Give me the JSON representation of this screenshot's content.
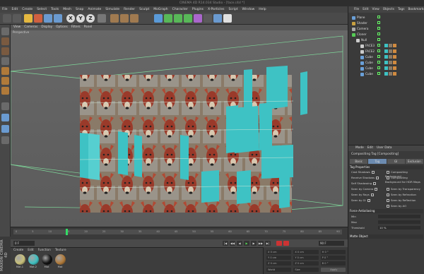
{
  "window": {
    "title": "CINEMA 4D R14.034 Studio - [face.c4d *]"
  },
  "menubar": [
    "File",
    "Edit",
    "Create",
    "Select",
    "Tools",
    "Mesh",
    "Snap",
    "Animate",
    "Simulate",
    "Render",
    "Sculpt",
    "MoGraph",
    "Character",
    "Plugins",
    "X-Particles",
    "Script",
    "Window",
    "Help"
  ],
  "toolbar": {
    "axis_x": "X",
    "axis_y": "Y",
    "axis_z": "Z"
  },
  "viewport": {
    "menu": [
      "View",
      "Cameras",
      "Display",
      "Options",
      "Filters",
      "Panel"
    ],
    "label": "Perspective"
  },
  "timeline": {
    "ticks": [
      "0",
      "5",
      "10",
      "15",
      "20",
      "25",
      "30",
      "35",
      "40",
      "45",
      "50",
      "55",
      "60",
      "65",
      "70",
      "75",
      "80",
      "85",
      "90"
    ],
    "current_frame": "0 F",
    "end_frame": "90 F"
  },
  "material_manager": {
    "menu": [
      "Create",
      "Edit",
      "Function",
      "Texture"
    ],
    "materials": [
      {
        "label": "Mat.1",
        "color": "#c8c07a"
      },
      {
        "label": "Mat.2",
        "color": "#3fbfc0"
      },
      {
        "label": "Mat",
        "color": "#111111"
      },
      {
        "label": "Mat",
        "color": "#b07a3a"
      }
    ]
  },
  "brand": "MAXON CINEMA 4D",
  "coordinates": {
    "rows": [
      [
        "X 0 cm",
        "X 0 cm",
        "H 0 °"
      ],
      [
        "Y 0 cm",
        "Y 0 cm",
        "P 0 °"
      ],
      [
        "Z 0 cm",
        "Z 0 cm",
        "B 0 °"
      ]
    ],
    "mode_label": "World",
    "size_label": "Size",
    "apply_label": "Apply"
  },
  "object_manager": {
    "menu": [
      "File",
      "Edit",
      "View",
      "Objects",
      "Tags",
      "Bookmarks"
    ],
    "objects": [
      {
        "name": "Plane",
        "color": "#6aa0d8",
        "indent": 0
      },
      {
        "name": "Shader",
        "color": "#c8a040",
        "indent": 0
      },
      {
        "name": "Camera",
        "color": "#aaaaaa",
        "indent": 0
      },
      {
        "name": "Cloner",
        "color": "#55cc55",
        "indent": 0
      },
      {
        "name": "Null",
        "color": "#cccccc",
        "indent": 1
      },
      {
        "name": "FACE3",
        "color": "#cccccc",
        "indent": 2
      },
      {
        "name": "FACE2",
        "color": "#cccccc",
        "indent": 2
      },
      {
        "name": "Cube",
        "color": "#6aa0d8",
        "indent": 2
      },
      {
        "name": "Cube",
        "color": "#6aa0d8",
        "indent": 2
      },
      {
        "name": "Cube",
        "color": "#6aa0d8",
        "indent": 2
      },
      {
        "name": "Cube",
        "color": "#6aa0d8",
        "indent": 2
      }
    ]
  },
  "attributes": {
    "menu": [
      "Mode",
      "Edit",
      "User Data"
    ],
    "title": "Compositing Tag [Compositing]",
    "tabs": [
      "Basic",
      "Tag",
      "GI",
      "Exclusion"
    ],
    "section_tag": "Tag Properties",
    "left_options": [
      "Cast Shadows",
      "Receive Shadows",
      "Self Shadowing",
      "Seen by Camera",
      "Seen by Rays",
      "Seen by GI"
    ],
    "right_options": [
      "Compositing Background",
      "Compositing Background for HDR Maps",
      "",
      "Seen by Transparency",
      "Seen by Refraction",
      "Seen by Reflection",
      "Seen by AO"
    ],
    "force_antialiasing": "Force Antialiasing",
    "fields": [
      "Min",
      "Max",
      "Threshold"
    ],
    "threshold_value": "10 %",
    "matte_object": "Matte Object"
  }
}
